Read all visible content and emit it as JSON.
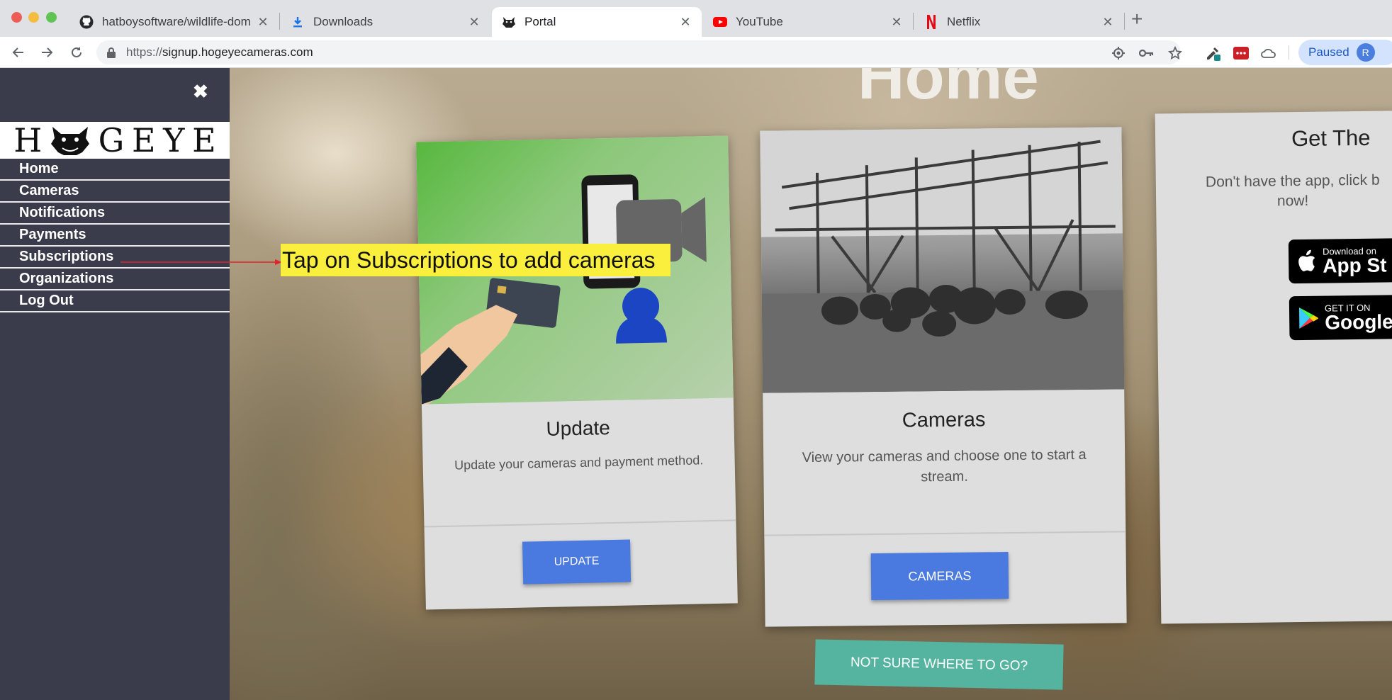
{
  "browser": {
    "tabs": [
      {
        "label": "hatboysoftware/wildlife-domin",
        "icon": "github-icon"
      },
      {
        "label": "Downloads",
        "icon": "download-icon"
      },
      {
        "label": "Portal",
        "icon": "hogeye-icon",
        "active": true
      },
      {
        "label": "YouTube",
        "icon": "youtube-icon"
      },
      {
        "label": "Netflix",
        "icon": "netflix-icon"
      }
    ],
    "url_scheme": "https://",
    "url_host": "signup.hogeyecameras.com",
    "profile_status": "Paused",
    "profile_initial": "R",
    "colors": {
      "accent": "#1a73e8",
      "youtube": "#ff0000",
      "netflix": "#e50914"
    }
  },
  "sidebar": {
    "logo_letters": [
      "H",
      "G",
      "E",
      "Y",
      "E"
    ],
    "items": [
      {
        "label": "Home"
      },
      {
        "label": "Cameras"
      },
      {
        "label": "Notifications"
      },
      {
        "label": "Payments"
      },
      {
        "label": "Subscriptions"
      },
      {
        "label": "Organizations"
      },
      {
        "label": "Log Out"
      }
    ]
  },
  "main": {
    "title": "Home",
    "cards": [
      {
        "title": "Update",
        "text": "Update your cameras and payment method.",
        "button": "UPDATE"
      },
      {
        "title": "Cameras",
        "text": "View your cameras and choose one to start a stream.",
        "button": "CAMERAS"
      },
      {
        "title": "Get The ",
        "text": "Don't have the app, click b now!",
        "badges": [
          {
            "small": "Download on",
            "big": "App St"
          },
          {
            "small": "GET IT ON",
            "big": "Google"
          }
        ]
      }
    ],
    "help_button": "NOT SURE WHERE TO GO?",
    "colors": {
      "button": "#4a7ae0",
      "help_button": "#55b4a0"
    }
  },
  "annotation": {
    "text": "Tap on Subscriptions to add cameras",
    "color": "#f9ef3c"
  }
}
